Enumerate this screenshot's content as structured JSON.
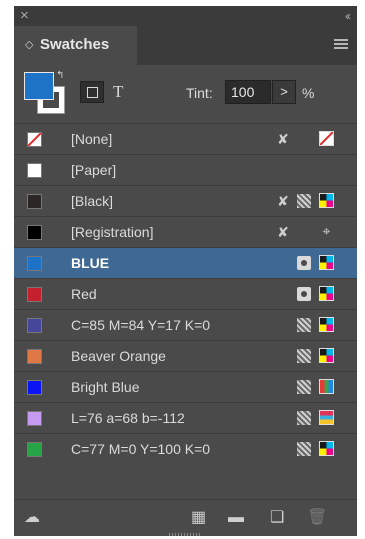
{
  "window": {
    "close_glyph": "×",
    "collapse_glyph": "‹‹"
  },
  "panel": {
    "tab_title": "Swatches",
    "tab_arrows_glyph": "◇",
    "menu_icon": "panel-menu-icon"
  },
  "controls": {
    "fill_color": "#1f73c6",
    "swap_glyph": "↰",
    "text_glyph": "T",
    "tint_label": "Tint:",
    "tint_value": "100",
    "tint_step_glyph": ">",
    "tint_unit": "%"
  },
  "swatches": [
    {
      "name": "[None]",
      "chip": "none",
      "noedit": "✘",
      "type": "none"
    },
    {
      "name": "[Paper]",
      "chip": "#ffffff",
      "noedit": "",
      "type": ""
    },
    {
      "name": "[Black]",
      "chip": "#2b2727",
      "noedit": "✘",
      "type": "process-cmyk"
    },
    {
      "name": "[Registration]",
      "chip": "#000000",
      "noedit": "✘",
      "type": "registration"
    },
    {
      "name": "BLUE",
      "chip": "#1f73c6",
      "noedit": "",
      "type": "spot-cmyk",
      "selected": true
    },
    {
      "name": "Red",
      "chip": "#c4202e",
      "noedit": "",
      "type": "spot-cmyk"
    },
    {
      "name": "C=85 M=84 Y=17 K=0",
      "chip": "#46469a",
      "noedit": "",
      "type": "process-cmyk"
    },
    {
      "name": "Beaver Orange",
      "chip": "#e07845",
      "noedit": "",
      "type": "process-cmyk"
    },
    {
      "name": "Bright Blue",
      "chip": "#0a14f5",
      "noedit": "",
      "type": "process-rgb"
    },
    {
      "name": "L=76 a=68 b=-112",
      "chip": "#c59af0",
      "noedit": "",
      "type": "process-lab"
    },
    {
      "name": "C=77 M=0 Y=100 K=0",
      "chip": "#27a546",
      "noedit": "",
      "type": "process-cmyk"
    }
  ],
  "bottom": {
    "cc_library_glyph": "☁",
    "show_kinds_glyph": "▦",
    "new_group_glyph": "▬",
    "new_swatch_glyph": "❏",
    "delete_glyph": "🗑"
  }
}
